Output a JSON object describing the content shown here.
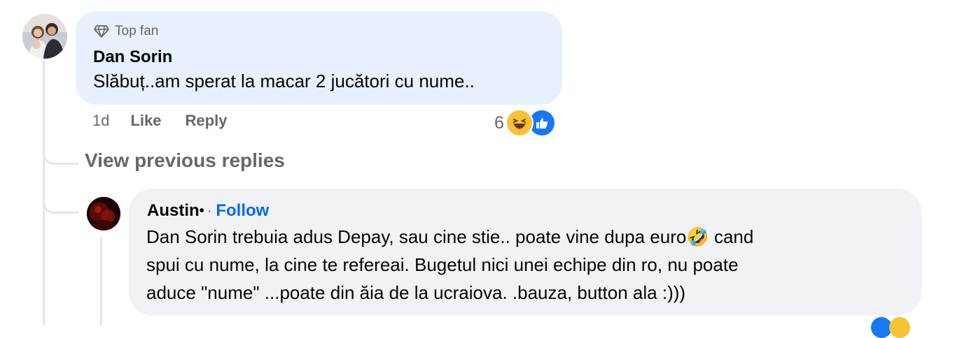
{
  "comment": {
    "badge_label": "Top fan",
    "author": "Dan Sorin",
    "text": "Slăbuț..am sperat la macar 2 jucători cu nume..",
    "time": "1d",
    "like_label": "Like",
    "reply_label": "Reply",
    "reaction_count": "6",
    "reactions": [
      "haha-icon",
      "like-icon"
    ]
  },
  "view_previous_label": "View previous replies",
  "reply": {
    "author": "Austin",
    "author_suffix": "•",
    "separator": "·",
    "follow_label": "Follow",
    "line1": "Dan Sorin trebuia adus Depay, sau cine stie.. poate vine dupa euro🤣 cand",
    "line2": "spui cu nume, la cine te refereai. Bugetul nici unei echipe din ro, nu poate",
    "line3": "aduce \"nume\" ...poate din ăia de la ucraiova. .bauza, button ala :)))"
  },
  "colors": {
    "bubble_top": "#e7f0fd",
    "bubble_reply": "#f0f2f5",
    "secondary_text": "#65676b",
    "follow_blue": "#0866ff",
    "like_blue": "#1877f2",
    "haha_yellow": "#f7c332"
  }
}
